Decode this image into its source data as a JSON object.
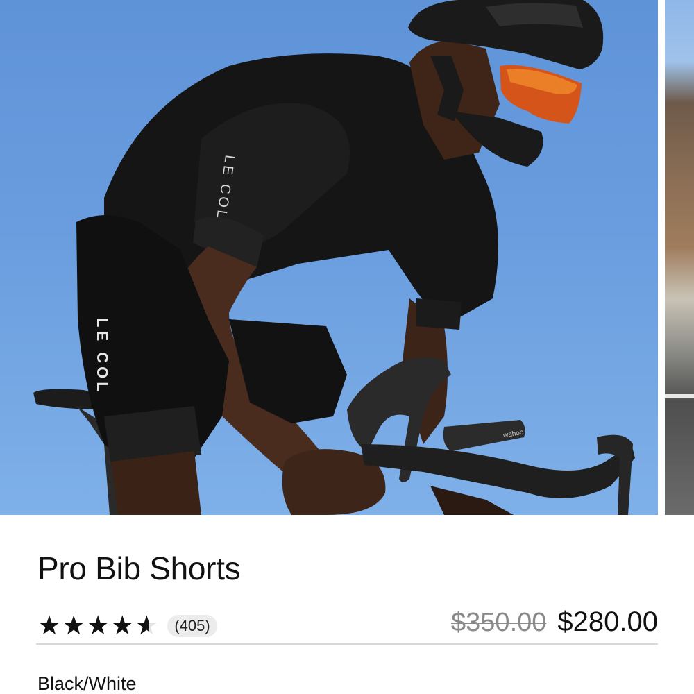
{
  "gallery": {
    "main_image_alt": "Cyclist riding a road bike in black jersey and bib shorts",
    "jersey_logo_text": "LE COL",
    "shorts_logo_text": "LE COL",
    "computer_brand_text": "wahoo"
  },
  "product": {
    "title": "Pro Bib Shorts",
    "rating": 4.6,
    "rating_max": 5,
    "stars_glyphs": "★★★★★",
    "review_count": "(405)",
    "price_original": "$350.00",
    "price_sale": "$280.00",
    "color_label": "Black/White"
  },
  "colors": {
    "text": "#111111",
    "strike": "#8a8a8a",
    "badge_bg": "#ececec",
    "divider": "#d8d8d8",
    "sky": "#6a9ddf"
  }
}
